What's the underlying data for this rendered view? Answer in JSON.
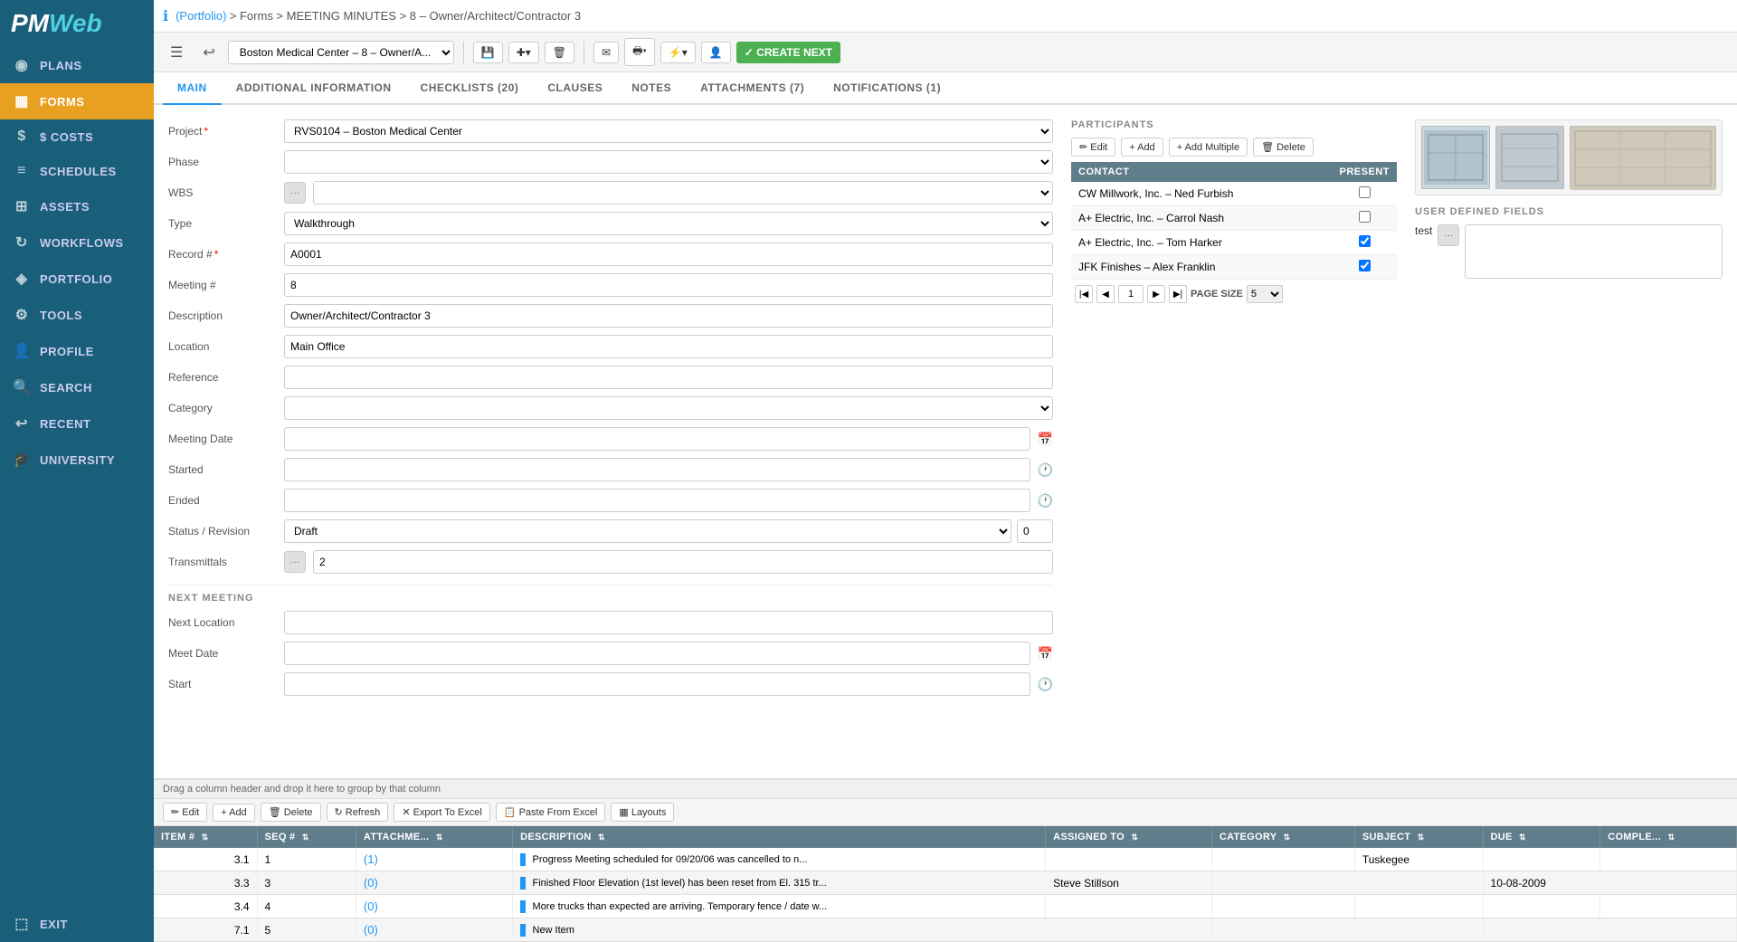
{
  "sidebar": {
    "logo": "PMWeb",
    "items": [
      {
        "id": "plans",
        "label": "Plans",
        "icon": "◉"
      },
      {
        "id": "forms",
        "label": "Forms",
        "icon": "▦",
        "active": true
      },
      {
        "id": "costs",
        "label": "$ Costs",
        "icon": "$"
      },
      {
        "id": "schedules",
        "label": "Schedules",
        "icon": "≡"
      },
      {
        "id": "assets",
        "label": "Assets",
        "icon": "⊞"
      },
      {
        "id": "workflows",
        "label": "Workflows",
        "icon": "↻"
      },
      {
        "id": "portfolio",
        "label": "Portfolio",
        "icon": "◈"
      },
      {
        "id": "tools",
        "label": "Tools",
        "icon": "⚙"
      },
      {
        "id": "profile",
        "label": "Profile",
        "icon": "👤"
      },
      {
        "id": "search",
        "label": "Search",
        "icon": "🔍"
      },
      {
        "id": "recent",
        "label": "Recent",
        "icon": "↩"
      },
      {
        "id": "university",
        "label": "University",
        "icon": "🎓"
      },
      {
        "id": "exit",
        "label": "Exit",
        "icon": "⬚"
      }
    ]
  },
  "topbar": {
    "info_icon": "ℹ",
    "breadcrumb": "(Portfolio) > Forms > MEETING MINUTES > 8 – Owner/Architect/Contractor 3"
  },
  "toolbar": {
    "project_value": "Boston Medical Center – 8 – Owner/A...",
    "save_label": "💾",
    "add_label": "✚+",
    "delete_label": "🗑",
    "email_label": "✉",
    "print_label": "🖶",
    "lightning_label": "⚡",
    "person_label": "👤",
    "create_next_label": "✓ CREATE NEXT"
  },
  "tabs": [
    {
      "id": "main",
      "label": "Main",
      "active": true
    },
    {
      "id": "additional",
      "label": "Additional Information"
    },
    {
      "id": "checklists",
      "label": "Checklists (20)"
    },
    {
      "id": "clauses",
      "label": "Clauses"
    },
    {
      "id": "notes",
      "label": "Notes"
    },
    {
      "id": "attachments",
      "label": "Attachments (7)"
    },
    {
      "id": "notifications",
      "label": "Notifications (1)"
    }
  ],
  "form": {
    "project_label": "Project",
    "project_value": "RVS0104 – Boston Medical Center",
    "phase_label": "Phase",
    "phase_value": "",
    "wbs_label": "WBS",
    "wbs_value": "",
    "type_label": "Type",
    "type_value": "Walkthrough",
    "record_label": "Record #",
    "record_value": "A0001",
    "meeting_label": "Meeting #",
    "meeting_value": "8",
    "description_label": "Description",
    "description_value": "Owner/Architect/Contractor 3",
    "location_label": "Location",
    "location_value": "Main Office",
    "reference_label": "Reference",
    "reference_value": "",
    "category_label": "Category",
    "category_value": "",
    "meeting_date_label": "Meeting Date",
    "meeting_date_value": "",
    "started_label": "Started",
    "started_value": "",
    "ended_label": "Ended",
    "ended_value": "",
    "status_label": "Status / Revision",
    "status_value": "Draft",
    "revision_value": "0",
    "transmittals_label": "Transmittals",
    "transmittals_value": "2",
    "next_meeting_header": "NEXT MEETING",
    "next_location_label": "Next Location",
    "next_location_value": "",
    "meet_date_label": "Meet Date",
    "meet_date_value": "",
    "start_label": "Start",
    "start_value": ""
  },
  "participants": {
    "title": "PARTICIPANTS",
    "toolbar_buttons": [
      "✏ Edit",
      "+ Add",
      "+ Add Multiple",
      "🗑 Delete"
    ],
    "columns": [
      "CONTACT",
      "PRESENT"
    ],
    "rows": [
      {
        "contact": "CW Millwork, Inc. – Ned Furbish",
        "present": false
      },
      {
        "contact": "A+ Electric, Inc. – Carrol Nash",
        "present": false
      },
      {
        "contact": "A+ Electric, Inc. – Tom Harker",
        "present": true
      },
      {
        "contact": "JFK Finishes – Alex Franklin",
        "present": true
      }
    ],
    "pagination": {
      "current_page": "1",
      "page_size_label": "PAGE SIZE",
      "page_size_value": "5"
    }
  },
  "user_defined": {
    "title": "USER DEFINED FIELDS",
    "field_label": "test",
    "field_value": ""
  },
  "grid": {
    "drag_hint": "Drag a column header and drop it here to group by that column",
    "toolbar_buttons": [
      "✏ Edit",
      "+ Add",
      "🗑 Delete",
      "↻ Refresh",
      "✕ Export To Excel",
      "📋 Paste From Excel",
      "▦ Layouts"
    ],
    "columns": [
      "ITEM #",
      "SEQ #",
      "ATTACHME...",
      "DESCRIPTION",
      "ASSIGNED TO",
      "CATEGORY",
      "SUBJECT",
      "DUE",
      "COMPLE..."
    ],
    "rows": [
      {
        "item": "3.1",
        "seq": "1",
        "attach": "(1)",
        "description": "Progress Meeting scheduled for 09/20/06 was cancelled to n...",
        "assigned_to": "",
        "category": "",
        "subject": "Tuskegee",
        "due": "",
        "complete": ""
      },
      {
        "item": "3.3",
        "seq": "3",
        "attach": "(0)",
        "description": "Finished Floor Elevation (1st level) has been reset from El. 315 tr...",
        "assigned_to": "Steve Stillson",
        "category": "",
        "subject": "",
        "due": "10-08-2009",
        "complete": ""
      },
      {
        "item": "3.4",
        "seq": "4",
        "attach": "(0)",
        "description": "More trucks than expected are arriving. Temporary fence / date w...",
        "assigned_to": "",
        "category": "",
        "subject": "",
        "due": "",
        "complete": ""
      },
      {
        "item": "7.1",
        "seq": "5",
        "attach": "(0)",
        "description": "New Item",
        "assigned_to": "",
        "category": "",
        "subject": "",
        "due": "",
        "complete": ""
      }
    ]
  }
}
